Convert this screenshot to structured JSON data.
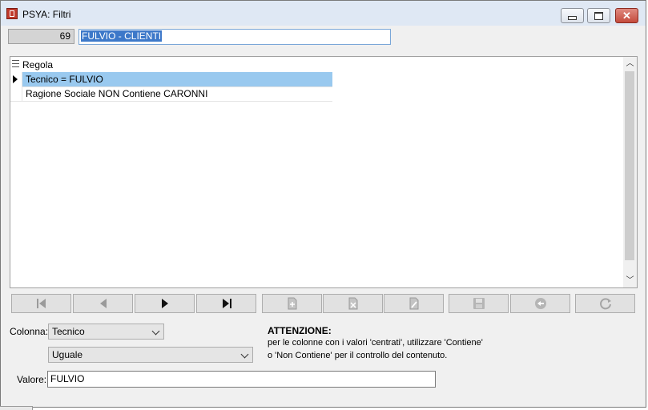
{
  "window": {
    "title": "PSYA: Filtri",
    "icon": "app-icon"
  },
  "header": {
    "count": "69",
    "filter_name": "FULVIO - CLIENTI"
  },
  "grid": {
    "column_header": "Regola",
    "rows": [
      {
        "text": "Tecnico = FULVIO",
        "selected": true
      },
      {
        "text": "Ragione Sociale NON Contiene CARONNI",
        "selected": false
      }
    ]
  },
  "toolbar": {
    "buttons": [
      "first-icon",
      "prev-icon",
      "next-icon",
      "last-icon",
      "insert-icon",
      "delete-icon",
      "edit-icon",
      "save-icon",
      "cancel-icon",
      "refresh-icon"
    ]
  },
  "form": {
    "colonna_label": "Colonna:",
    "colonna_value": "Tecnico",
    "operator_value": "Uguale",
    "valore_label": "Valore:",
    "valore_value": "FULVIO"
  },
  "notice": {
    "title": "ATTENZIONE:",
    "line1": "per le colonne con i valori 'centrati', utilizzare 'Contiene'",
    "line2": "o 'Non Contiene' per il controllo del contenuto."
  }
}
